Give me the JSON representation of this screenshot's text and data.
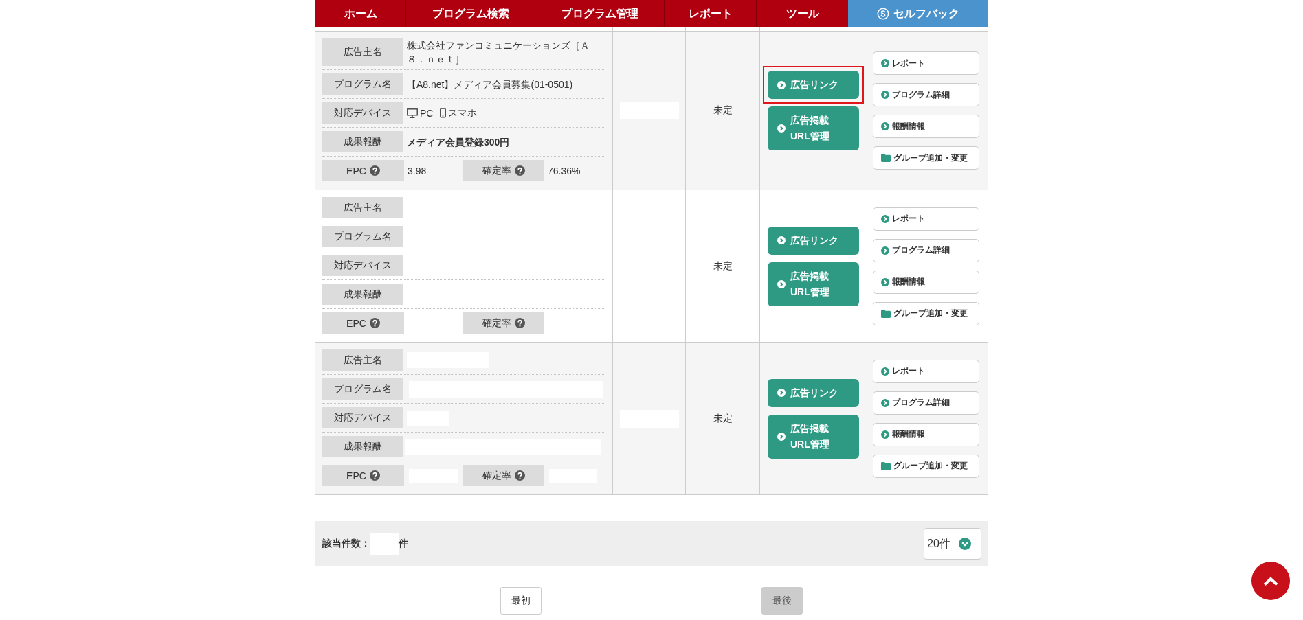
{
  "nav": [
    {
      "label": "ホーム",
      "kind": "menu"
    },
    {
      "label": "プログラム検索",
      "kind": "menu"
    },
    {
      "label": "プログラム管理",
      "kind": "menu"
    },
    {
      "label": "レポート",
      "kind": "menu"
    },
    {
      "label": "ツール",
      "kind": "menu"
    },
    {
      "label": "セルフバック",
      "kind": "selfback"
    }
  ],
  "table": {
    "rows": [
      {
        "advertiser": {
          "label": "広告主名",
          "value": "株式会社ファンコミュニケーションズ［Ａ８．ｎｅｔ］"
        },
        "program": {
          "label": "プログラム名",
          "value": "【A8.net】メディア会員募集(01-0501)"
        },
        "devices": {
          "label": "対応デバイス",
          "items": [
            {
              "kind": "pc",
              "label": "PC"
            },
            {
              "kind": "smartphone",
              "label": "スマホ"
            }
          ]
        },
        "reward": {
          "label": "成果報酬",
          "value": "メディア会員登録300円"
        },
        "epc": {
          "label": "EPC",
          "value": "3.98"
        },
        "approval_rate": {
          "label": "確定率",
          "value": "76.36%"
        },
        "column_2": {
          "redacted": true
        },
        "status": "未定",
        "primary_buttons": [
          {
            "label": "広告リンク",
            "highlighted": true
          },
          {
            "label": "広告掲載 URL管理",
            "highlighted": false
          }
        ],
        "secondary_buttons": [
          {
            "kind": "link",
            "label": "レポート"
          },
          {
            "kind": "link",
            "label": "プログラム詳細"
          },
          {
            "kind": "link",
            "label": "報酬情報"
          },
          {
            "kind": "folder",
            "label": "グループ追加・変更"
          }
        ]
      },
      {
        "advertiser": {
          "label": "広告主名"
        },
        "program": {
          "label": "プログラム名"
        },
        "devices": {
          "label": "対応デバイス"
        },
        "reward": {
          "label": "成果報酬"
        },
        "epc": {
          "label": "EPC"
        },
        "approval_rate": {
          "label": "確定率"
        },
        "status": "未定",
        "primary_buttons": [
          {
            "label": "広告リンク",
            "highlighted": false
          },
          {
            "label": "広告掲載 URL管理",
            "highlighted": false
          }
        ],
        "secondary_buttons": [
          {
            "kind": "link",
            "label": "レポート"
          },
          {
            "kind": "link",
            "label": "プログラム詳細"
          },
          {
            "kind": "link",
            "label": "報酬情報"
          },
          {
            "kind": "folder",
            "label": "グループ追加・変更"
          }
        ]
      },
      {
        "advertiser": {
          "label": "広告主名",
          "redacted": true
        },
        "program": {
          "label": "プログラム名",
          "redacted": true
        },
        "devices": {
          "label": "対応デバイス",
          "redacted": true
        },
        "reward": {
          "label": "成果報酬",
          "redacted": true
        },
        "epc": {
          "label": "EPC",
          "redacted": true
        },
        "approval_rate": {
          "label": "確定率",
          "redacted": true
        },
        "column_2": {
          "redacted": true
        },
        "status": "未定",
        "primary_buttons": [
          {
            "label": "広告リンク",
            "highlighted": false
          },
          {
            "label": "広告掲載 URL管理",
            "highlighted": false
          }
        ],
        "secondary_buttons": [
          {
            "kind": "link",
            "label": "レポート"
          },
          {
            "kind": "link",
            "label": "プログラム詳細"
          },
          {
            "kind": "link",
            "label": "報酬情報"
          },
          {
            "kind": "folder",
            "label": "グループ追加・変更"
          }
        ]
      }
    ]
  },
  "result_count": {
    "label": "該当件数：",
    "redacted": true,
    "unit": "件"
  },
  "per_page": {
    "value": "20件"
  },
  "pagination": [
    {
      "label": "最初",
      "disabled": false
    },
    {
      "label": "最後",
      "disabled": true
    }
  ]
}
